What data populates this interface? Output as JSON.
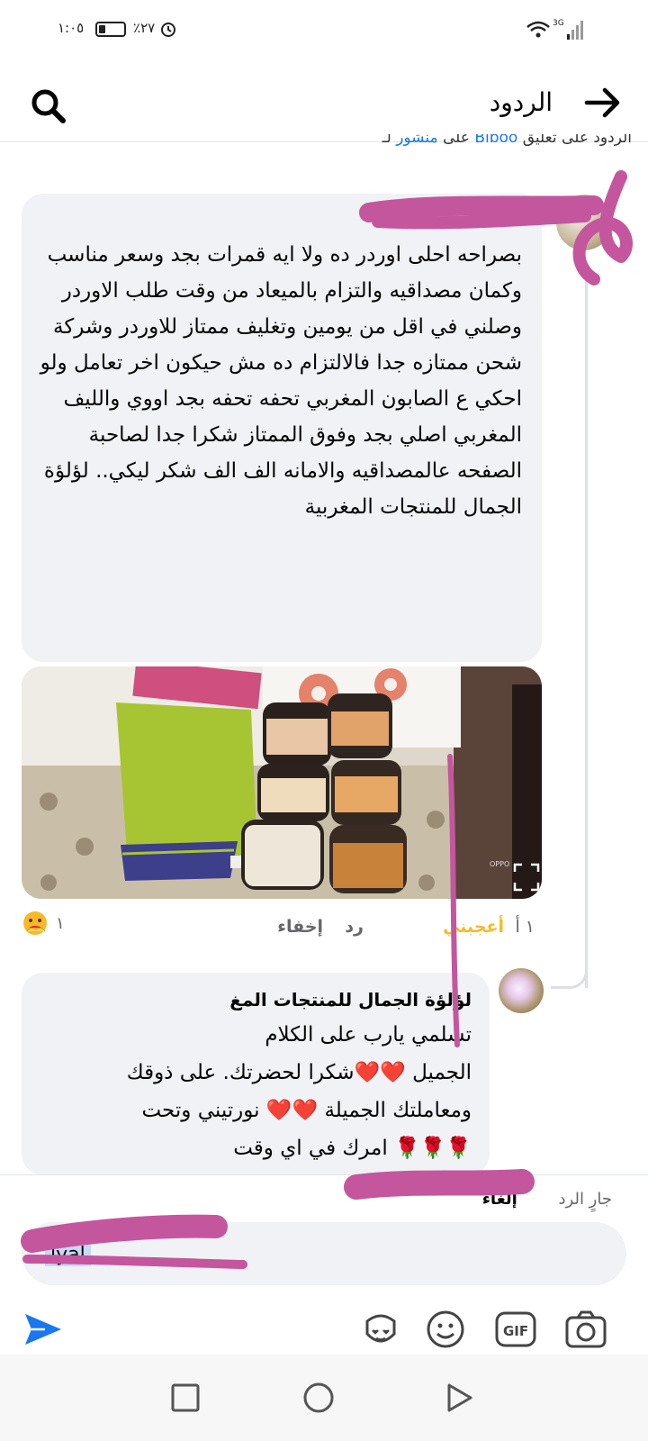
{
  "status_bar": {
    "time": "١:٠٥",
    "battery": "٪٢٧",
    "battery_level_pct": 27,
    "network": "3G"
  },
  "header": {
    "title": "الردود",
    "back_icon": "arrow-right-icon",
    "search_icon": "search-icon"
  },
  "context": {
    "prefix": "الردود على تعليق",
    "commenter": "Biboo",
    "on": "على",
    "post": "منشور",
    "suffix": "لـ"
  },
  "comment": {
    "author": "",
    "text": "بصراحه احلى اوردر ده ولا ايه قمرات بجد وسعر مناسب وكمان مصداقيه والتزام بالميعاد من وقت طلب الاوردر وصلني في اقل من يومين وتغليف ممتاز للاوردر وشركة شحن ممتازه جدا فالالتزام ده مش حيكون اخر تعامل ولو احكي ع الصابون المغربي تحفه تحفه بجد اووي والليف المغربي اصلي بجد وفوق الممتاز شكرا جدا لصاحبة الصفحه عالمصداقيه والامانه الف الف شكر ليكي..   لؤلؤة الجمال للمنتجات المغربية",
    "photo_watermark": "OPPO",
    "time": "١ أ",
    "like_label": "أعجبني",
    "reply_label": "رد",
    "hide_label": "إخفاء",
    "reaction_icon": "care-reaction-icon",
    "reaction_count": "١"
  },
  "reply": {
    "author": "لؤلؤة الجمال للمنتجات المغ",
    "line1": "تسلمي يارب على الكلام",
    "line2a": "الجميل",
    "hearts2": "❤️❤️",
    "line2b": "شكرا لحضرتك. على ذوقك",
    "line3a": "ومعاملتك الجميلة",
    "hearts3": "❤️❤️",
    "line3b": "نورتيني وتحت",
    "roses": "🌹🌹🌹",
    "line4": "امرك في اي وقت"
  },
  "composer": {
    "replying_to": "جارٍ الرد",
    "cancel_label": "إلغاء",
    "input_value": "lyal",
    "send_icon": "send-icon",
    "tools": [
      "camera-icon",
      "gif-icon",
      "emoji-icon",
      "avatar-sticker-icon"
    ]
  },
  "nav": [
    "back-triangle-icon",
    "home-circle-icon",
    "recents-square-icon"
  ],
  "colors": {
    "accent": "#1877f2",
    "bubble": "#f0f2f5",
    "like": "#f7b928",
    "redaction": "#c4569e"
  }
}
